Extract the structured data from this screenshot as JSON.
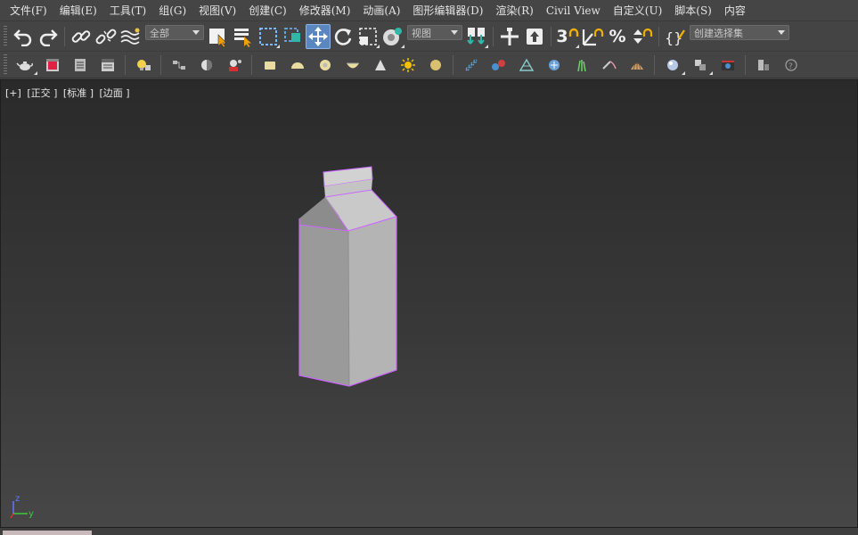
{
  "menu": {
    "items": [
      {
        "label": "文件(F)"
      },
      {
        "label": "编辑(E)"
      },
      {
        "label": "工具(T)"
      },
      {
        "label": "组(G)"
      },
      {
        "label": "视图(V)"
      },
      {
        "label": "创建(C)"
      },
      {
        "label": "修改器(M)"
      },
      {
        "label": "动画(A)"
      },
      {
        "label": "图形编辑器(D)"
      },
      {
        "label": "渲染(R)"
      },
      {
        "label": "Civil View"
      },
      {
        "label": "自定义(U)"
      },
      {
        "label": "脚本(S)"
      },
      {
        "label": "内容"
      }
    ]
  },
  "toolbar": {
    "selection_filter": "全部",
    "reference_coord": "视图",
    "named_selection_placeholder": "创建选择集",
    "snap_label": "3",
    "angle_snap_label": "∠",
    "percent_snap_label": "%"
  },
  "viewport": {
    "label_plus": "[+]",
    "label_view": "[正交 ]",
    "label_shading": "[标准 ]",
    "label_display": "[边面 ]",
    "axis_z": "z",
    "axis_y": "y"
  },
  "colors": {
    "selection_edge": "#cc66ff",
    "active_tool": "#5a87c0"
  }
}
